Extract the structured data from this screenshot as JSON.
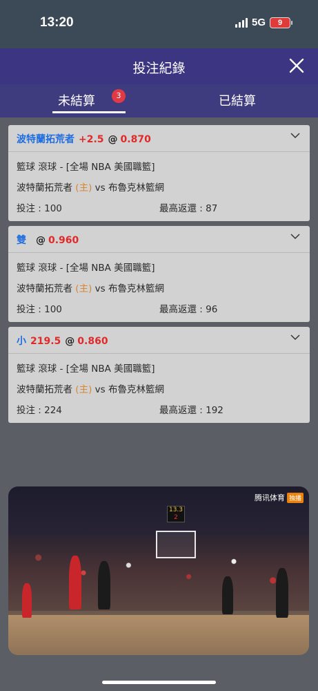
{
  "status_bar": {
    "time": "13:20",
    "network": "5G",
    "battery": "9"
  },
  "header": {
    "title": "投注紀錄"
  },
  "tabs": [
    {
      "label": "未結算",
      "badge": "3",
      "active": true
    },
    {
      "label": "已結算",
      "active": false
    }
  ],
  "bets": [
    {
      "selection": "波特蘭拓荒者",
      "line": "+2.5",
      "at": "@",
      "odds": "0.870",
      "market": "籃球 滾球 - [全場 NBA 美國職籃]",
      "home_team": "波特蘭拓荒者",
      "home_tag": "(主)",
      "vs": "vs",
      "away_team": "布魯克林籃網",
      "stake": "投注 : 100",
      "max_return": "最高返還 : 87"
    },
    {
      "selection": "雙",
      "line": "",
      "at": "@",
      "odds": "0.960",
      "market": "籃球 滾球 - [全場 NBA 美國職籃]",
      "home_team": "波特蘭拓荒者",
      "home_tag": "(主)",
      "vs": "vs",
      "away_team": "布魯克林籃網",
      "stake": "投注 : 100",
      "max_return": "最高返還 : 96"
    },
    {
      "selection": "小",
      "line": "219.5",
      "at": "@",
      "odds": "0.860",
      "market": "籃球 滾球 - [全場 NBA 美國職籃]",
      "home_team": "波特蘭拓荒者",
      "home_tag": "(主)",
      "vs": "vs",
      "away_team": "布魯克林籃網",
      "stake": "投注 : 224",
      "max_return": "最高返還 : 192"
    }
  ],
  "video": {
    "logo_text": "腾讯体育",
    "logo_tag": "独播",
    "shot_clock_top": "13.3",
    "shot_clock_bottom": "2"
  },
  "colors": {
    "header_bg": "#3b3582",
    "selection_blue": "#1f6de0",
    "odds_red": "#e02a2a",
    "home_tag_orange": "#d88630",
    "badge_red": "#e03a46"
  }
}
